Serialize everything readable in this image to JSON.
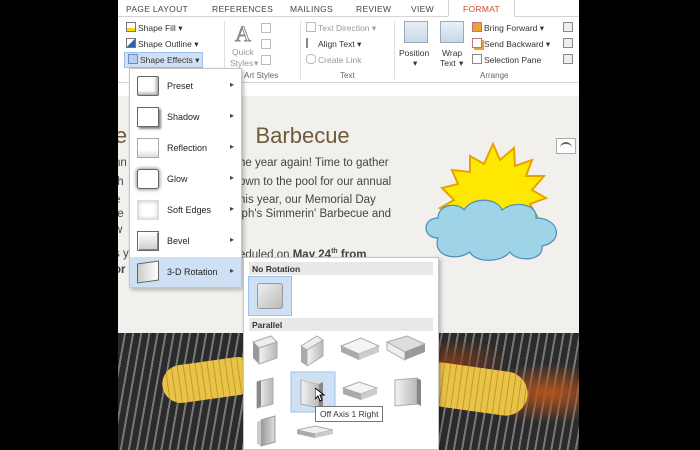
{
  "tabs": [
    "PAGE LAYOUT",
    "REFERENCES",
    "MAILINGS",
    "REVIEW",
    "VIEW",
    "FORMAT"
  ],
  "ribbon": {
    "shape_fill": "Shape Fill",
    "shape_outline": "Shape Outline",
    "shape_effects": "Shape Effects",
    "quick_styles": "Quick",
    "quick_styles_2": "Styles",
    "wordart_styles_group": "Art Styles",
    "text_direction": "Text Direction",
    "align_text": "Align Text",
    "create_link": "Create Link",
    "text_group": "Text",
    "position": "Position",
    "wrap_text": "Wrap",
    "wrap_text_2": "Text",
    "bring_forward": "Bring Forward",
    "send_backward": "Send Backward",
    "selection_pane": "Selection Pane",
    "arrange_group": "Arrange",
    "dropdown_glyph": "▾"
  },
  "document": {
    "title_left": "le",
    "title": "Barbecue",
    "lines": [
      {
        "l": "nn",
        "r": "he year again! Time to gather"
      },
      {
        "l": "th",
        "r": "own to the pool for our annual"
      },
      {
        "l": "e",
        "r": "his year, our Memorial Day"
      },
      {
        "l": "fe",
        "r": "lph's Simmerin' Barbecue and"
      },
      {
        "l": "w",
        "r": ""
      },
      {
        "l": "s y",
        "r": "eduled on "
      },
      {
        "l": "or",
        "r": ""
      }
    ],
    "date_bold": "May 24",
    "date_sup": "th",
    "date_tail": " from"
  },
  "shape_effects_menu": {
    "items": [
      {
        "label": "Preset",
        "arrow": "▸"
      },
      {
        "label": "Shadow",
        "arrow": "▸"
      },
      {
        "label": "Reflection",
        "arrow": "▸"
      },
      {
        "label": "Glow",
        "arrow": "▸"
      },
      {
        "label": "Soft Edges",
        "arrow": "▸"
      },
      {
        "label": "Bevel",
        "arrow": "▸"
      },
      {
        "label": "3-D Rotation",
        "arrow": "▸"
      }
    ]
  },
  "rotation_gallery": {
    "no_rotation_header": "No Rotation",
    "parallel_header": "Parallel",
    "tooltip": "Off Axis 1 Right"
  },
  "colors": {
    "accent": "#d0482c",
    "hover": "#cfe0f4",
    "sun": "#ffe800",
    "cloud": "#9fd3e8"
  }
}
